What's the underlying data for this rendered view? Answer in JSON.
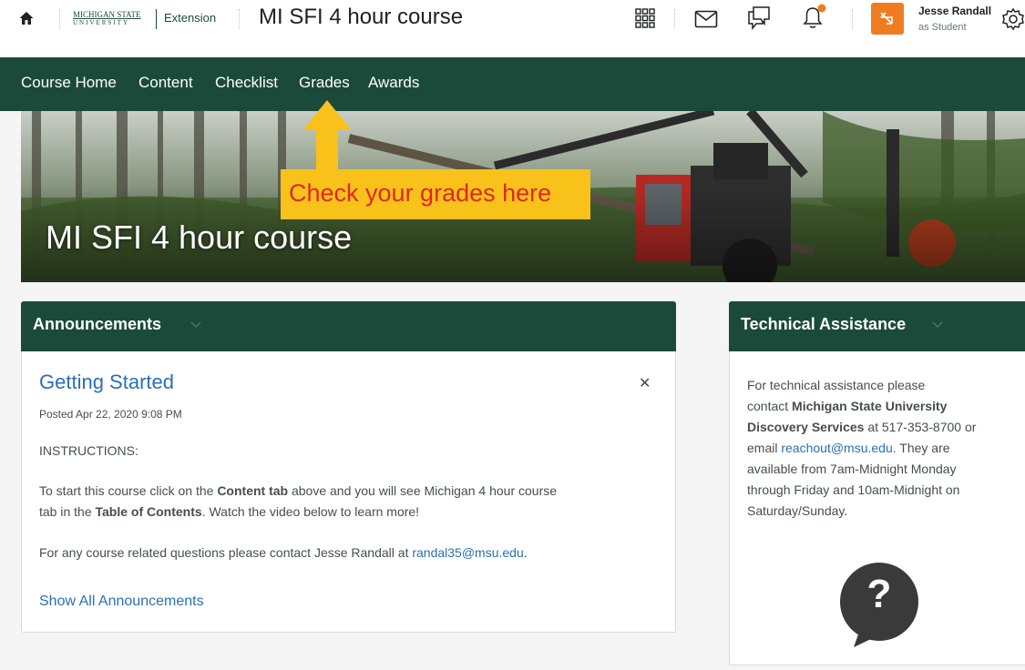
{
  "header": {
    "logo_line1": "MICHIGAN STATE",
    "logo_line2": "UNIVERSITY",
    "logo_extension": "Extension",
    "course_title": "MI SFI 4 hour course",
    "user_name": "Jesse Randall",
    "user_role": "as Student",
    "accent_color": "#f07c22"
  },
  "nav": {
    "items": [
      "Course Home",
      "Content",
      "Checklist",
      "Grades",
      "Awards"
    ],
    "bg_color": "#1b4a3b"
  },
  "hero": {
    "title": "MI SFI 4 hour course",
    "callout": "Check your grades here"
  },
  "announcements": {
    "title": "Announcements",
    "item_title": "Getting Started",
    "posted": "Posted Apr 22, 2020 9:08 PM",
    "heading": "INSTRUCTIONS:",
    "p1_a": "To start this course click on the ",
    "p1_b": "Content tab",
    "p1_c": " above and you will see Michigan 4 hour course",
    "p1_d": "tab in the ",
    "p1_e": "Table of Contents",
    "p1_f": ". Watch the video below to learn more!",
    "p2_a": "For any course related questions please contact Jesse Randall at ",
    "p2_email": "randal35@msu.edu",
    "p2_end": ".",
    "show_all": "Show All Announcements",
    "close_glyph": "✕"
  },
  "tech": {
    "title": "Technical Assistance",
    "l1": "For technical assistance please",
    "l2a": "contact ",
    "l2b": "Michigan State University",
    "l3a": "Discovery Services",
    "l3b": " at 517-353-8700 or",
    "l4a": "email ",
    "l4email": "reachout@msu.edu",
    "l4b": ". They are",
    "l5": "available from 7am-Midnight Monday",
    "l6": "through Friday and 10am-Midnight on",
    "l7": "Saturday/Sunday.",
    "help_glyph": "?"
  },
  "icons": [
    "home-icon",
    "waffle-grid-icon",
    "mail-icon",
    "chat-icon",
    "bell-icon",
    "role-switch-icon",
    "gear-icon",
    "chevron-down-icon",
    "close-icon",
    "help-bubble-icon",
    "up-arrow-icon"
  ]
}
